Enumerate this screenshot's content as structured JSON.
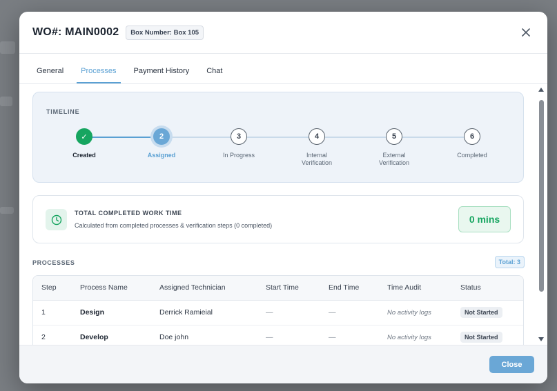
{
  "modal": {
    "title": "WO#: MAIN0002",
    "box_badge": "Box Number: Box 105"
  },
  "tabs": [
    {
      "label": "General",
      "active": false
    },
    {
      "label": "Processes",
      "active": true
    },
    {
      "label": "Payment History",
      "active": false
    },
    {
      "label": "Chat",
      "active": false
    }
  ],
  "timeline": {
    "title": "TIMELINE",
    "steps": [
      {
        "number": "✓",
        "label": "Created",
        "state": "done"
      },
      {
        "number": "2",
        "label": "Assigned",
        "state": "active"
      },
      {
        "number": "3",
        "label": "In Progress",
        "state": "pending"
      },
      {
        "number": "4",
        "label": "Internal Verification",
        "state": "pending"
      },
      {
        "number": "5",
        "label": "External Verification",
        "state": "pending"
      },
      {
        "number": "6",
        "label": "Completed",
        "state": "pending"
      }
    ]
  },
  "work_time": {
    "title": "TOTAL COMPLETED WORK TIME",
    "subtitle": "Calculated from completed processes & verification steps (0 completed)",
    "value": "0 mins",
    "icon": "clock-icon"
  },
  "processes": {
    "heading": "PROCESSES",
    "total": "Total: 3",
    "columns": [
      "Step",
      "Process Name",
      "Assigned Technician",
      "Start Time",
      "End Time",
      "Time Audit",
      "Status"
    ],
    "rows": [
      {
        "step": "1",
        "name": "Design",
        "technician": "Derrick Ramieial",
        "start": "—",
        "end": "—",
        "audit": "No activity logs",
        "status": "Not Started"
      },
      {
        "step": "2",
        "name": "Develop",
        "technician": "Doe john",
        "start": "—",
        "end": "—",
        "audit": "No activity logs",
        "status": "Not Started"
      }
    ]
  },
  "footer": {
    "close_label": "Close"
  },
  "colors": {
    "accent": "#5aa0d3",
    "success": "#16a560"
  }
}
